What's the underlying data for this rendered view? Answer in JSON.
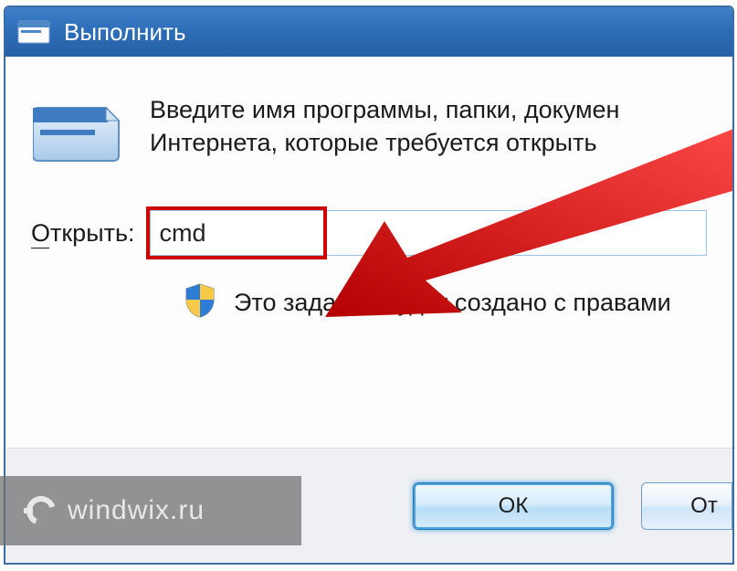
{
  "window": {
    "title": "Выполнить"
  },
  "body": {
    "description": "Введите имя программы, папки, докумен\nИнтернета, которые требуется открыть",
    "open_label": "Открыть:",
    "open_value": "cmd",
    "admin_note": "Это задание будет создано с правами"
  },
  "footer": {
    "ok_label": "ОК",
    "cancel_label": "От"
  },
  "watermark": {
    "text": "windwix.ru"
  }
}
